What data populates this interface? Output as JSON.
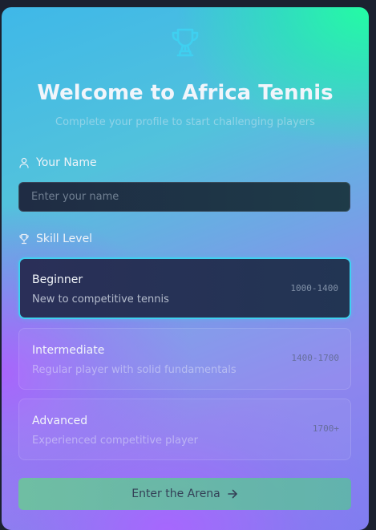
{
  "header": {
    "icon": "trophy-icon",
    "title": "Welcome to Africa Tennis",
    "subtitle": "Complete your profile to start challenging players"
  },
  "name_field": {
    "icon": "user-icon",
    "label": "Your Name",
    "placeholder": "Enter your name",
    "value": ""
  },
  "skill": {
    "icon": "trophy-icon",
    "label": "Skill Level",
    "selected": "Beginner",
    "levels": [
      {
        "name": "Beginner",
        "description": "New to competitive tennis",
        "range": "1000-1400"
      },
      {
        "name": "Intermediate",
        "description": "Regular player with solid fundamentals",
        "range": "1400-1700"
      },
      {
        "name": "Advanced",
        "description": "Experienced competitive player",
        "range": "1700+"
      }
    ]
  },
  "submit": {
    "label": "Enter the Arena",
    "icon": "arrow-right-icon"
  },
  "colors": {
    "accent_cyan": "#3fd0f0",
    "gradient_green": "#21ffa0",
    "gradient_purple": "#b05cff",
    "button_green": "#6cc49c"
  }
}
